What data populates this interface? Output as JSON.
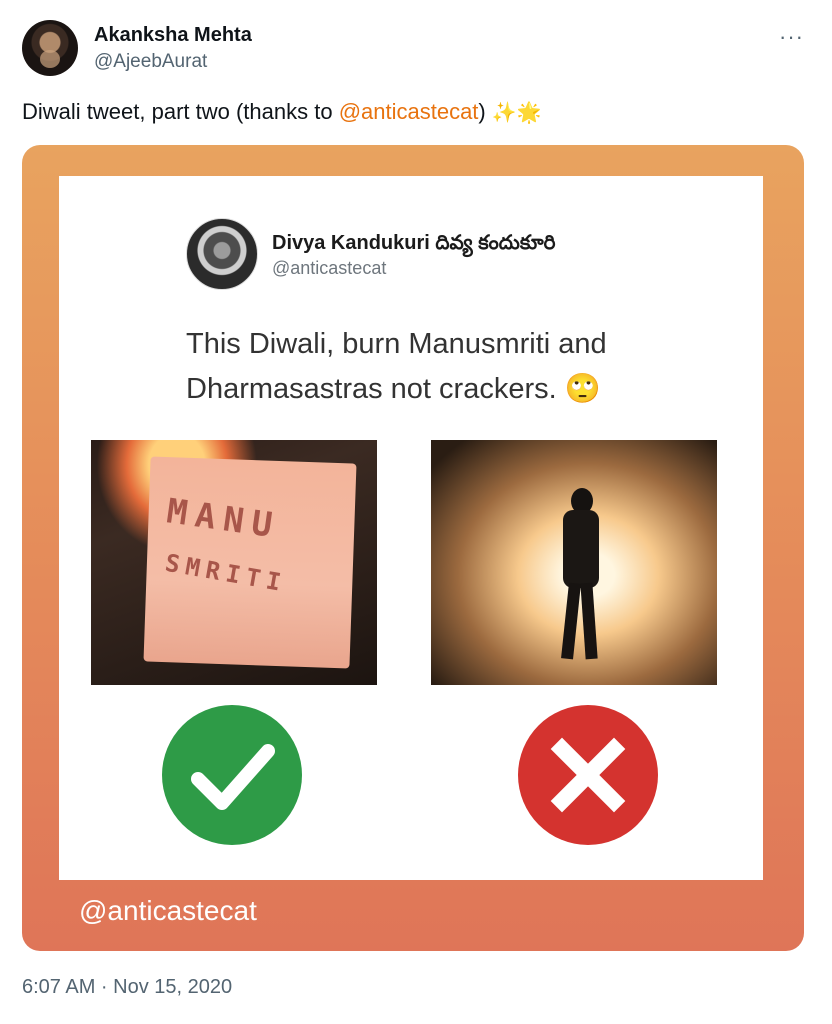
{
  "author": {
    "name": "Akanksha Mehta",
    "handle": "@AjeebAurat",
    "more_label": "···"
  },
  "tweet": {
    "text_before": "Diwali tweet, part two (thanks to ",
    "mention": "@anticastecat",
    "text_after": ") ",
    "emojis": "✨🌟"
  },
  "embedded": {
    "name": "Divya Kandukuri దివ్య కందుకూరి",
    "handle": "@anticastecat",
    "text": "This Diwali, burn Manusmriti and Dharmasastras not crackers. 🙄",
    "paper_line1": "MANU",
    "paper_line2": "SMRITI"
  },
  "watermark": "@anticastecat",
  "timestamp": "6:07 AM · Nov 15, 2020",
  "colors": {
    "mention": "#e8730f",
    "check": "#2e9b47",
    "cross": "#d4332f"
  }
}
